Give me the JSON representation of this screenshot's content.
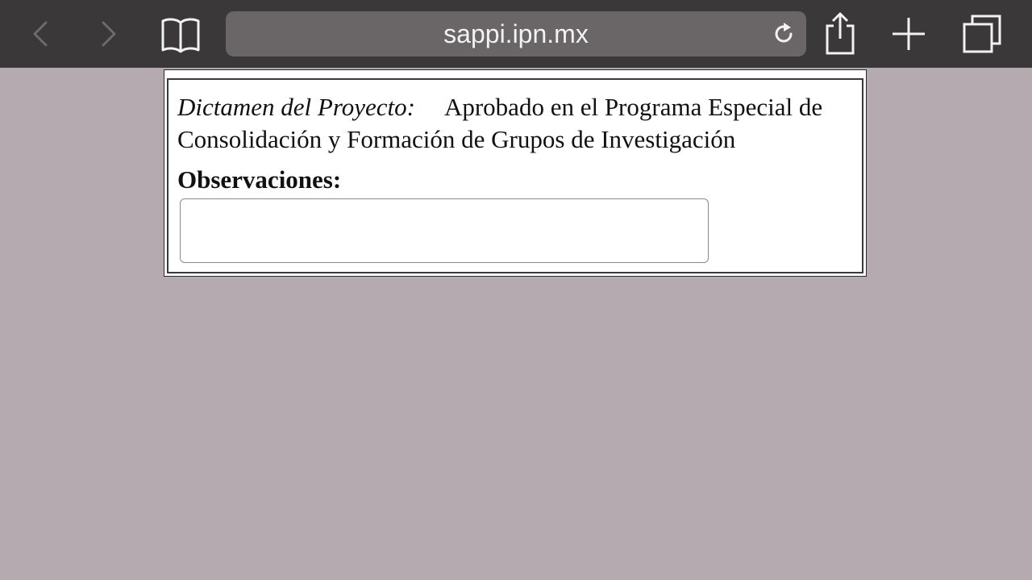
{
  "browser": {
    "url": "sappi.ipn.mx",
    "icons": {
      "back": "chevron-left-icon",
      "forward": "chevron-right-icon",
      "bookmarks": "book-icon",
      "reload": "reload-icon",
      "share": "share-icon",
      "new_tab": "plus-icon",
      "tabs": "tabs-icon"
    }
  },
  "form": {
    "dictamen_label": "Dictamen del Proyecto:",
    "dictamen_value": "Aprobado en el Programa Especial de Consolidación y Formación de Grupos de Investigación",
    "observaciones_label": "Observaciones:",
    "observaciones_value": ""
  },
  "colors": {
    "toolbar": "#3a3839",
    "urlbar": "#6a6567",
    "page_background": "#b4aab0",
    "panel": "#ffffff"
  }
}
